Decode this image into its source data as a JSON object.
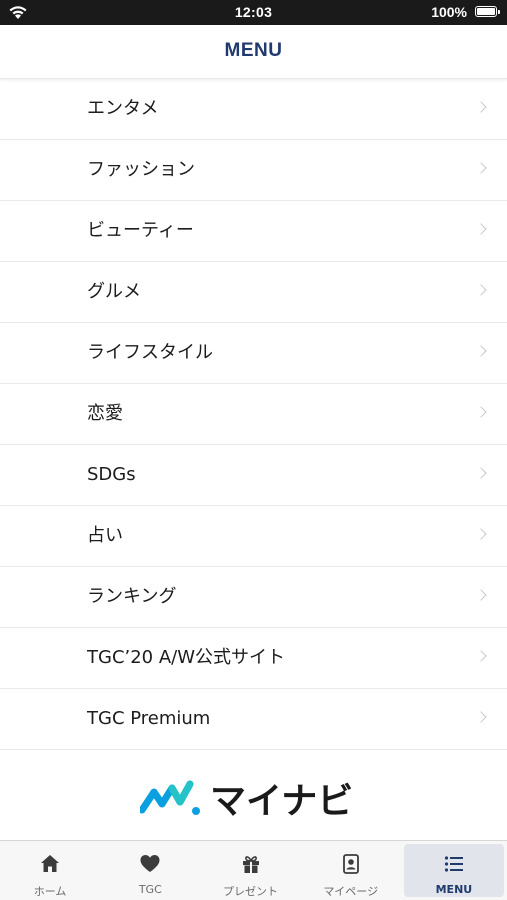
{
  "status_bar": {
    "time": "12:03",
    "battery": "100%",
    "wifi_icon": "wifi-icon",
    "battery_icon": "battery-icon"
  },
  "header": {
    "title": "MENU"
  },
  "menu": {
    "items": [
      {
        "label": "エンタメ"
      },
      {
        "label": "ファッション"
      },
      {
        "label": "ビューティー"
      },
      {
        "label": "グルメ"
      },
      {
        "label": "ライフスタイル"
      },
      {
        "label": "恋愛"
      },
      {
        "label": "SDGs"
      },
      {
        "label": "占い"
      },
      {
        "label": "ランキング"
      },
      {
        "label": "TGC’20 A/W公式サイト"
      },
      {
        "label": "TGC Premium"
      }
    ],
    "chevron_icon": "chevron-right-icon"
  },
  "logo": {
    "text": "マイナビ",
    "brand_colors": {
      "blue": "#0aa0e0",
      "teal": "#23c3c8",
      "text": "#1a1a1a"
    }
  },
  "tab_bar": {
    "tabs": [
      {
        "label": "ホーム",
        "icon": "home-icon",
        "active": false
      },
      {
        "label": "TGC",
        "icon": "heart-icon",
        "active": false
      },
      {
        "label": "プレゼント",
        "icon": "gift-icon",
        "active": false
      },
      {
        "label": "マイページ",
        "icon": "profile-icon",
        "active": false
      },
      {
        "label": "MENU",
        "icon": "list-icon",
        "active": true
      }
    ]
  },
  "colors": {
    "accent": "#203a6e",
    "active_tab_bg": "#e1e4ea",
    "separator": "#e9e9e9"
  }
}
